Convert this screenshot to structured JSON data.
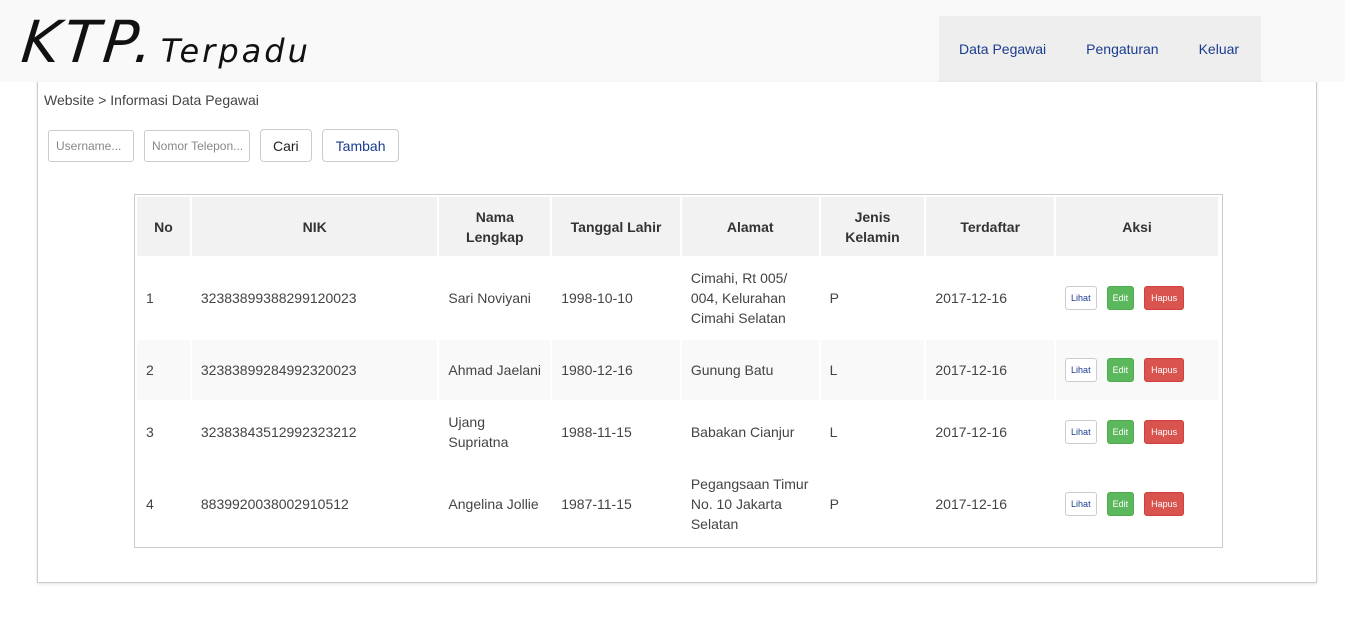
{
  "header": {
    "logo_main": "KTP.",
    "logo_sub": "Terpadu",
    "nav": [
      "Data Pegawai",
      "Pengaturan",
      "Keluar"
    ]
  },
  "breadcrumb": "Website > Informasi Data Pegawai",
  "search": {
    "username_placeholder": "Username...",
    "phone_placeholder": "Nomor Telepon...",
    "cari_label": "Cari",
    "tambah_label": "Tambah"
  },
  "table": {
    "headers": [
      "No",
      "NIK",
      "Nama Lengkap",
      "Tanggal Lahir",
      "Alamat",
      "Jenis Kelamin",
      "Terdaftar",
      "Aksi"
    ],
    "rows": [
      {
        "no": "1",
        "nik": "32383899388299120023",
        "nama": "Sari Noviyani",
        "tgl": "1998-10-10",
        "alamat": "Cimahi, Rt 005/ 004, Kelurahan Cimahi Selatan",
        "jk": "P",
        "terdaftar": "2017-12-16"
      },
      {
        "no": "2",
        "nik": "32383899284992320023",
        "nama": "Ahmad Jaelani",
        "tgl": "1980-12-16",
        "alamat": "Gunung Batu",
        "jk": "L",
        "terdaftar": "2017-12-16"
      },
      {
        "no": "3",
        "nik": "32383843512992323212",
        "nama": "Ujang Supriatna",
        "tgl": "1988-11-15",
        "alamat": "Babakan Cianjur",
        "jk": "L",
        "terdaftar": "2017-12-16"
      },
      {
        "no": "4",
        "nik": "8839920038002910512",
        "nama": "Angelina Jollie",
        "tgl": "1987-11-15",
        "alamat": "Pegangsaan Timur No. 10 Jakarta Selatan",
        "jk": "P",
        "terdaftar": "2017-12-16"
      }
    ],
    "actions": {
      "lihat": "Lihat",
      "edit": "Edit",
      "hapus": "Hapus"
    }
  }
}
